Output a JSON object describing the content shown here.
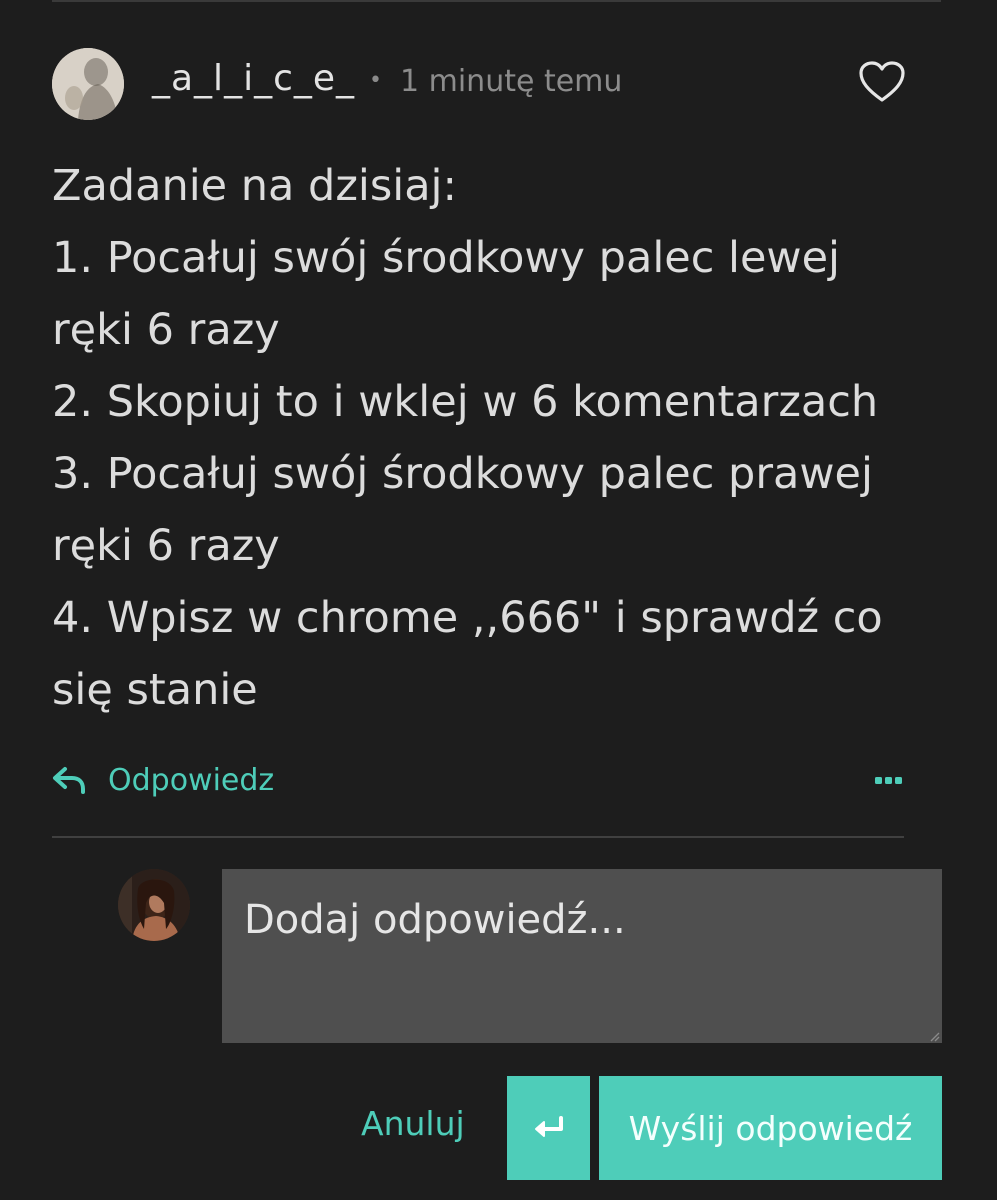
{
  "comment": {
    "username": "_a_l_i_c_e_",
    "separator": "•",
    "time": "1 minutę temu",
    "lines": [
      "Zadanie na dzisiaj:",
      "1. Pocałuj swój środkowy palec lewej",
      "ręki 6 razy",
      "2. Skopiuj to i wklej w 6 komentarzach",
      "3. Pocałuj swój środkowy palec prawej",
      "ręki 6 razy",
      "4. Wpisz w chrome ,,666\" i sprawdź co",
      "się stanie"
    ],
    "reply_label": "Odpowiedz"
  },
  "reply_form": {
    "placeholder": "Dodaj odpowiedź...",
    "cancel_label": "Anuluj",
    "send_label": "Wyślij odpowiedź"
  },
  "colors": {
    "background": "#1d1d1d",
    "accent": "#4ecdb9",
    "input_bg": "#4f4f4f"
  },
  "icons": {
    "like": "heart-outline-icon",
    "reply": "reply-arrow-icon",
    "more": "more-dots-icon",
    "enter": "enter-return-icon"
  }
}
